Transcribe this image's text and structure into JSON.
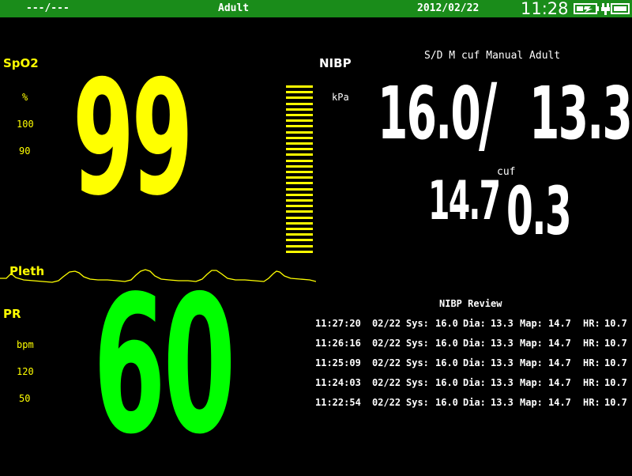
{
  "status_bar": {
    "bed": "---/---",
    "patient_type": "Adult",
    "date": "2012/02/22",
    "time": "11:28",
    "icons": [
      "battery-icon",
      "plug-icon"
    ]
  },
  "spo2": {
    "label": "SpO2",
    "unit": "%",
    "alarm_high": "100",
    "alarm_low": "90",
    "value": "99",
    "color": "#ffff00",
    "pleth_label": "Pleth"
  },
  "pr": {
    "label": "PR",
    "unit": "bpm",
    "alarm_high": "120",
    "alarm_low": "50",
    "value": "60",
    "color": "#00ff00"
  },
  "nibp": {
    "label": "NIBP",
    "unit": "kPa",
    "mode": "S/D M cuf Manual Adult",
    "systolic": "16.0",
    "separator": "/",
    "diastolic": "13.3",
    "mean": "14.7",
    "cuf_label": "cuf",
    "cuff_pressure": "0.3"
  },
  "review": {
    "title": "NIBP Review",
    "labels": {
      "sys": "Sys:",
      "dia": "Dia:",
      "map": "Map:",
      "hr": "HR:"
    },
    "rows": [
      {
        "time": "11:27:20",
        "date": "02/22",
        "sys": "16.0",
        "dia": "13.3",
        "map": "14.7",
        "hr": "10.7"
      },
      {
        "time": "11:26:16",
        "date": "02/22",
        "sys": "16.0",
        "dia": "13.3",
        "map": "14.7",
        "hr": "10.7"
      },
      {
        "time": "11:25:09",
        "date": "02/22",
        "sys": "16.0",
        "dia": "13.3",
        "map": "14.7",
        "hr": "10.7"
      },
      {
        "time": "11:24:03",
        "date": "02/22",
        "sys": "16.0",
        "dia": "13.3",
        "map": "14.7",
        "hr": "10.7"
      },
      {
        "time": "11:22:54",
        "date": "02/22",
        "sys": "16.0",
        "dia": "13.3",
        "map": "14.7",
        "hr": "10.7"
      }
    ]
  }
}
